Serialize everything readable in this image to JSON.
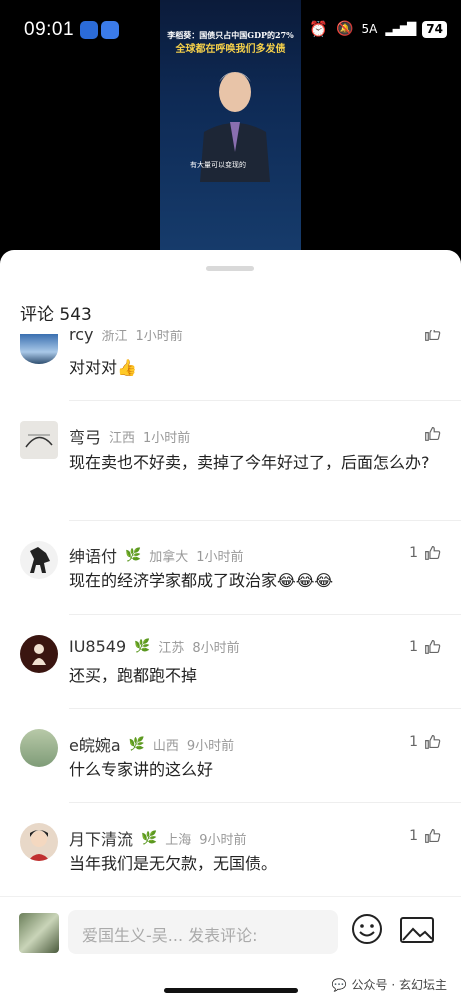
{
  "status": {
    "time": "09:01",
    "network": "5A",
    "battery": "74"
  },
  "video": {
    "headline_top": "李稻葵：国债只占中国GDP的27%",
    "headline_main": "全球都在呼唤我们多发债",
    "subtitle": "有大量可以变现的"
  },
  "comments_header": {
    "label": "评论",
    "count": "543"
  },
  "comments": [
    {
      "name": "rcy",
      "location": "浙江",
      "time": "1小时前",
      "text": "对对对👍",
      "likes": ""
    },
    {
      "name": "弯弓",
      "location": "江西",
      "time": "1小时前",
      "text": "现在卖也不好卖，卖掉了今年好过了，后面怎么办?",
      "likes": ""
    },
    {
      "name": "绅语付",
      "location": "加拿大",
      "time": "1小时前",
      "text": "现在的经济学家都成了政治家😂😂😂",
      "likes": "1"
    },
    {
      "name": "IU8549",
      "location": "江苏",
      "time": "8小时前",
      "text": "还买，跑都跑不掉",
      "likes": "1"
    },
    {
      "name": "e皖婉a",
      "location": "山西",
      "time": "9小时前",
      "text": "什么专家讲的这么好",
      "likes": "1"
    },
    {
      "name": "月下清流",
      "location": "上海",
      "time": "9小时前",
      "text": "当年我们是无欠款，无国债。",
      "likes": "1"
    }
  ],
  "composer": {
    "placeholder": "爱国生义-吴... 发表评论:"
  },
  "watermark": "公众号 · 玄幻坛主",
  "colors": {
    "badge": "#d4a02a",
    "meta": "#999999"
  }
}
